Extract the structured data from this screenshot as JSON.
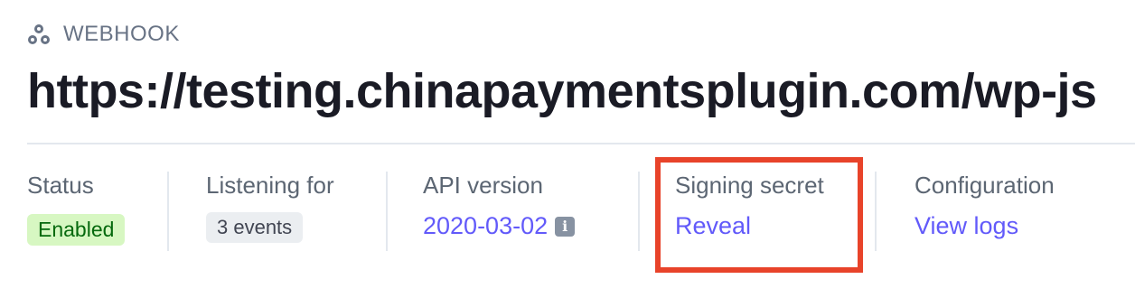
{
  "header": {
    "kicker_label": "WEBHOOK",
    "kicker_icon": "webhook-icon",
    "title": "https://testing.chinapaymentsplugin.com/wp-js"
  },
  "details": {
    "status": {
      "label": "Status",
      "value": "Enabled",
      "color": "#05690d"
    },
    "listening": {
      "label": "Listening for",
      "value": "3 events"
    },
    "api_version": {
      "label": "API version",
      "value": "2020-03-02",
      "info_icon": "info-icon",
      "info_glyph": "i"
    },
    "signing_secret": {
      "label": "Signing secret",
      "action": "Reveal"
    },
    "configuration": {
      "label": "Configuration",
      "action": "View logs"
    }
  },
  "colors": {
    "accent": "#625afa",
    "highlight": "#e8432a",
    "enabled_bg": "#d7f7c2"
  }
}
